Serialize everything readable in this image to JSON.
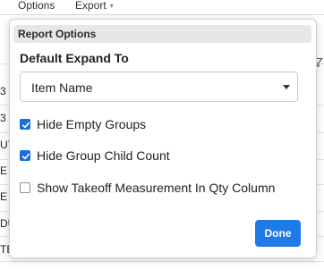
{
  "toolbar": {
    "options_label": "Options",
    "export_label": "Export",
    "export_caret": "▾"
  },
  "background": {
    "left_labels": [
      "3",
      "3",
      "UT",
      "E",
      "E",
      "DU",
      "TE"
    ]
  },
  "popup": {
    "title": "Report Options",
    "expand_section": {
      "title": "Default Expand To",
      "selected_value": "Item Name"
    },
    "options": [
      {
        "label": "Hide Empty Groups",
        "checked": true
      },
      {
        "label": "Hide Group Child Count",
        "checked": true
      },
      {
        "label": "Show Takeoff Measurement In Qty Column",
        "checked": false
      }
    ],
    "done_label": "Done"
  },
  "colors": {
    "accent": "#1e7ae6",
    "checkbox_checked": "#1a6fe0"
  }
}
